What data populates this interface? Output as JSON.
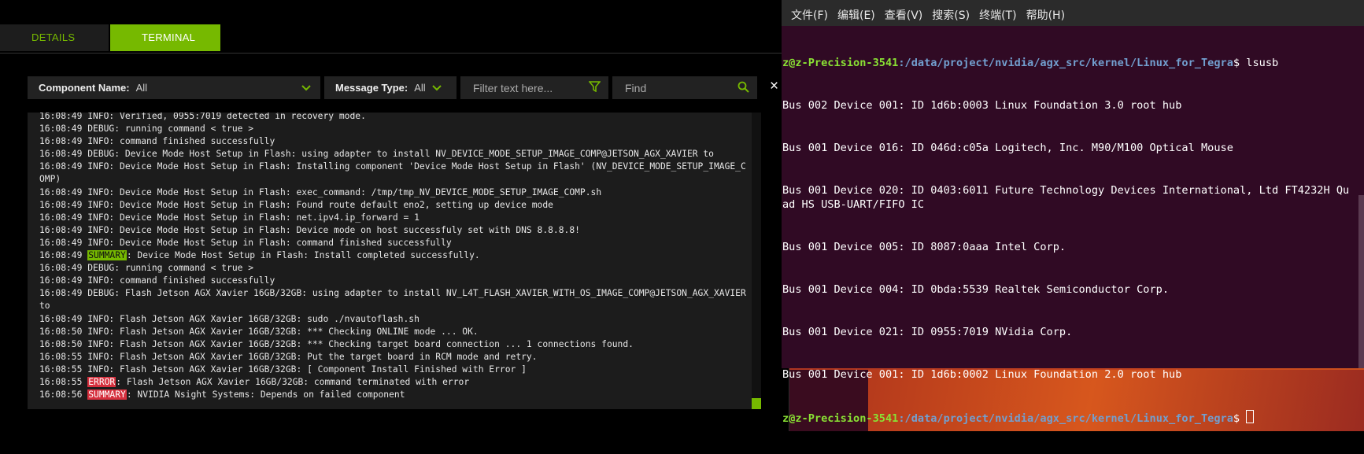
{
  "sdk": {
    "tabs": [
      "DETAILS",
      "TERMINAL"
    ],
    "filters": {
      "component_label": "Component Name:",
      "component_value": "All",
      "message_label": "Message Type:",
      "message_value": "All",
      "filter_placeholder": "Filter text here...",
      "find_placeholder": "Find",
      "close": "×"
    },
    "log": [
      {
        "text": "16:08:49 INFO: Verified, 0955:7019 detected in recovery mode."
      },
      {
        "text": "16:08:49 DEBUG: running command < true >"
      },
      {
        "text": "16:08:49 INFO: command finished successfully"
      },
      {
        "text": "16:08:49 DEBUG: Device Mode Host Setup in Flash: using adapter to install NV_DEVICE_MODE_SETUP_IMAGE_COMP@JETSON_AGX_XAVIER to"
      },
      {
        "text": "16:08:49 INFO: Device Mode Host Setup in Flash: Installing component 'Device Mode Host Setup in Flash' (NV_DEVICE_MODE_SETUP_IMAGE_COMP)"
      },
      {
        "text": "16:08:49 INFO: Device Mode Host Setup in Flash: exec_command: /tmp/tmp_NV_DEVICE_MODE_SETUP_IMAGE_COMP.sh"
      },
      {
        "text": "16:08:49 INFO: Device Mode Host Setup in Flash: Found route default eno2, setting up device mode"
      },
      {
        "text": "16:08:49 INFO: Device Mode Host Setup in Flash: net.ipv4.ip_forward = 1"
      },
      {
        "text": "16:08:49 INFO: Device Mode Host Setup in Flash: Device mode on host successfuly set with DNS 8.8.8.8!"
      },
      {
        "text": "16:08:49 INFO: Device Mode Host Setup in Flash: command finished successfully"
      },
      {
        "time": "16:08:49 ",
        "tag": "SUMMARY",
        "tag_style": "summary",
        "rest": ": Device Mode Host Setup in Flash: Install completed successfully."
      },
      {
        "text": "16:08:49 DEBUG: running command < true >"
      },
      {
        "text": "16:08:49 INFO: command finished successfully"
      },
      {
        "text": "16:08:49 DEBUG: Flash Jetson AGX Xavier 16GB/32GB: using adapter to install NV_L4T_FLASH_XAVIER_WITH_OS_IMAGE_COMP@JETSON_AGX_XAVIER to"
      },
      {
        "text": "16:08:49 INFO: Flash Jetson AGX Xavier 16GB/32GB: sudo ./nvautoflash.sh"
      },
      {
        "text": "16:08:50 INFO: Flash Jetson AGX Xavier 16GB/32GB: *** Checking ONLINE mode ... OK."
      },
      {
        "text": "16:08:50 INFO: Flash Jetson AGX Xavier 16GB/32GB: *** Checking target board connection ... 1 connections found."
      },
      {
        "text": "16:08:55 INFO: Flash Jetson AGX Xavier 16GB/32GB: Put the target board in RCM mode and retry."
      },
      {
        "text": "16:08:55 INFO: Flash Jetson AGX Xavier 16GB/32GB: [ Component Install Finished with Error ]"
      },
      {
        "time": "16:08:55 ",
        "tag": "ERROR",
        "tag_style": "error",
        "rest": ": Flash Jetson AGX Xavier 16GB/32GB: command terminated with error"
      },
      {
        "time": "16:08:56 ",
        "tag": "SUMMARY",
        "tag_style": "summary err",
        "rest": ": NVIDIA Nsight Systems: Depends on failed component"
      }
    ]
  },
  "terminal": {
    "menu": [
      "文件(F)",
      "编辑(E)",
      "查看(V)",
      "搜索(S)",
      "终端(T)",
      "帮助(H)"
    ],
    "prompt_user": "z@z-Precision-3541",
    "prompt_path": ":/data/project/nvidia/agx_src/kernel/Linux_for_Tegra",
    "prompt_sign": "$ ",
    "command": "lsusb",
    "output": [
      "Bus 002 Device 001: ID 1d6b:0003 Linux Foundation 3.0 root hub",
      "Bus 001 Device 016: ID 046d:c05a Logitech, Inc. M90/M100 Optical Mouse",
      "Bus 001 Device 020: ID 0403:6011 Future Technology Devices International, Ltd FT4232H Quad HS USB-UART/FIFO IC",
      "Bus 001 Device 005: ID 8087:0aaa Intel Corp.",
      "Bus 001 Device 004: ID 0bda:5539 Realtek Semiconductor Corp.",
      "Bus 001 Device 021: ID 0955:7019 NVidia Corp.",
      "Bus 001 Device 001: ID 1d6b:0002 Linux Foundation 2.0 root hub"
    ]
  }
}
